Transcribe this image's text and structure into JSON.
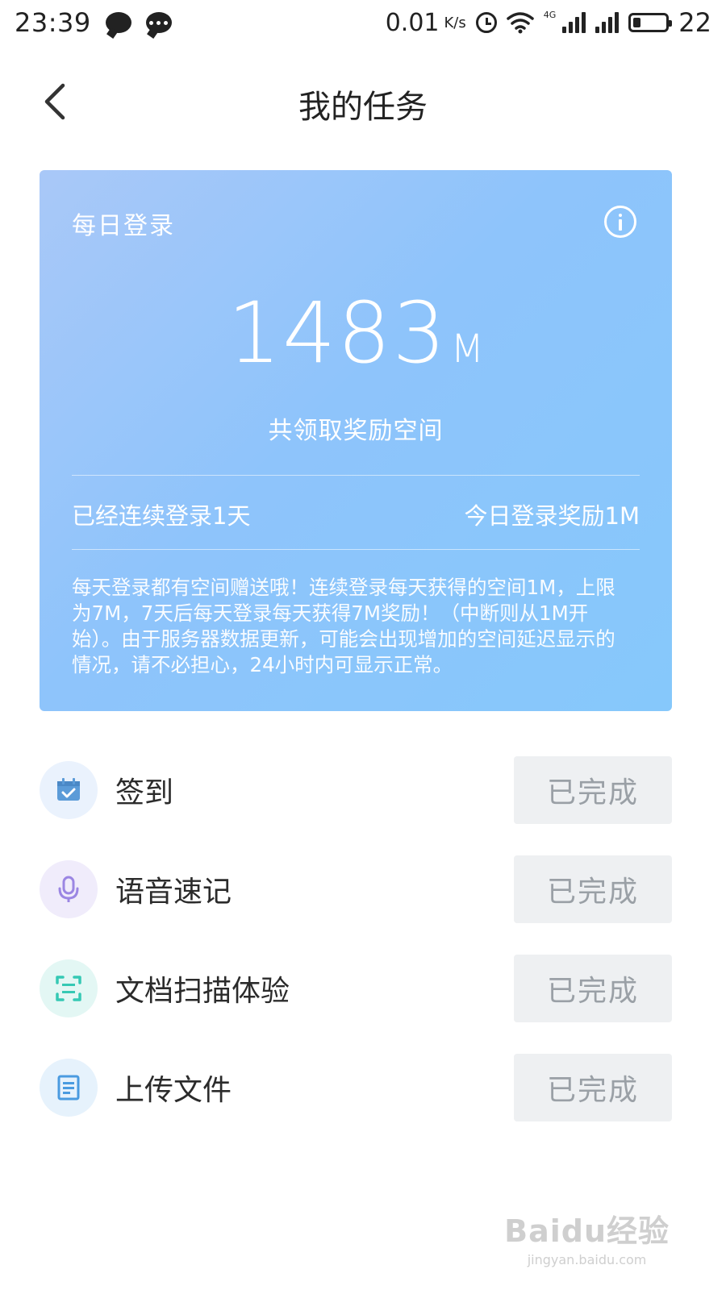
{
  "status_bar": {
    "time": "23:39",
    "net_speed": "0.01",
    "net_unit": "K/s",
    "network_tag": "4G",
    "battery_level": "22"
  },
  "nav": {
    "title": "我的任务"
  },
  "card": {
    "header": "每日登录",
    "reward_number": "1483",
    "reward_unit": "M",
    "reward_caption": "共领取奖励空间",
    "streak_text": "已经连续登录1天",
    "today_reward": "今日登录奖励1M",
    "description": "每天登录都有空间赠送哦！连续登录每天获得的空间1M，上限为7M，7天后每天登录每天获得7M奖励！（中断则从1M开始）。由于服务器数据更新，可能会出现增加的空间延迟显示的情况，请不必担心，24小时内可显示正常。"
  },
  "tasks": [
    {
      "label": "签到",
      "status": "已完成",
      "icon": "calendar-check-icon",
      "icon_color": "#5b9bd8",
      "icon_bg": "#eaf2fd"
    },
    {
      "label": "语音速记",
      "status": "已完成",
      "icon": "microphone-icon",
      "icon_color": "#9b86e3",
      "icon_bg": "#f0ecfb"
    },
    {
      "label": "文档扫描体验",
      "status": "已完成",
      "icon": "scan-icon",
      "icon_color": "#35c9b4",
      "icon_bg": "#e3f7f4"
    },
    {
      "label": "上传文件",
      "status": "已完成",
      "icon": "document-icon",
      "icon_color": "#4a9be0",
      "icon_bg": "#e6f2fc"
    }
  ],
  "watermark": {
    "logo": "Baidu经验",
    "url": "jingyan.baidu.com"
  },
  "colors": {
    "card_gradient_start": "#a9c8f8",
    "card_gradient_end": "#86c8fb",
    "button_bg": "#eef0f2",
    "button_text": "#9aa0a6"
  }
}
